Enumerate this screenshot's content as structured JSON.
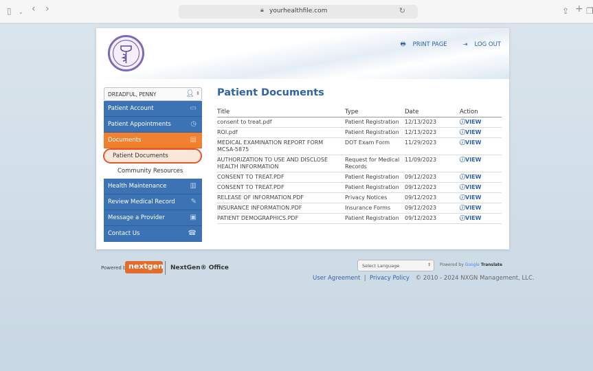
{
  "browser": {
    "url": "yourhealthfile.com",
    "sidebar_icon": "sidebar-icon",
    "back_glyph": "‹",
    "forward_glyph": "›"
  },
  "header": {
    "print_label": "PRINT PAGE",
    "logout_label": "LOG OUT"
  },
  "patient_select": {
    "value": "DREADFUL, PENNY"
  },
  "nav": {
    "items": [
      {
        "label": "Patient Account",
        "icon": "id-card-icon"
      },
      {
        "label": "Patient Appointments",
        "icon": "clock-icon"
      },
      {
        "label": "Documents",
        "icon": "document-icon",
        "active": true
      }
    ],
    "sub_items": [
      {
        "label": "Patient Documents",
        "selected": true
      },
      {
        "label": "Community Resources"
      }
    ],
    "items_after": [
      {
        "label": "Health Maintenance",
        "icon": "bar-chart-icon"
      },
      {
        "label": "Review Medical Record",
        "icon": "edit-icon"
      },
      {
        "label": "Message a Provider",
        "icon": "message-icon"
      },
      {
        "label": "Contact Us",
        "icon": "phone-icon"
      }
    ]
  },
  "main": {
    "title": "Patient Documents",
    "columns": [
      "Title",
      "Type",
      "Date",
      "Action"
    ],
    "view_label": "VIEW",
    "rows": [
      {
        "title": "consent to treat.pdf",
        "type": "Patient Registration",
        "date": "12/13/2023"
      },
      {
        "title": "ROI.pdf",
        "type": "Patient Registration",
        "date": "12/13/2023"
      },
      {
        "title": "MEDICAL EXAMINATION REPORT FORM MCSA-5875",
        "type": "DOT Exam Form",
        "date": "11/29/2023"
      },
      {
        "title": "AUTHORIZATION TO USE AND DISCLOSE HEALTH INFORMATION",
        "type": "Request for Medical Records",
        "date": "11/09/2023"
      },
      {
        "title": "CONSENT TO TREAT.PDF",
        "type": "Patient Registration",
        "date": "09/12/2023"
      },
      {
        "title": "CONSENT TO TREAT.PDF",
        "type": "Patient Registration",
        "date": "09/12/2023"
      },
      {
        "title": "RELEASE OF INFORMATION.PDF",
        "type": "Privacy Notices",
        "date": "09/12/2023"
      },
      {
        "title": "INSURANCE INFORMATION.PDF",
        "type": "Insurance Forms",
        "date": "09/12/2023"
      },
      {
        "title": "PATIENT DEMOGRAPHICS.PDF",
        "type": "Patient Registration",
        "date": "09/12/2023"
      }
    ]
  },
  "footer": {
    "powered_by": "Powered by",
    "brand_logo": "nextgen",
    "brand_office": "NextGen® Office",
    "language_select": "Select Language",
    "translate_prefix": "Powered by",
    "translate_google": "Google",
    "translate_word": "Translate",
    "user_agreement": "User Agreement",
    "privacy_policy": "Privacy Policy",
    "copyright": "© 2010 - 2024 NXGN Management, LLC."
  },
  "colors": {
    "nav_blue": "#3c73b4",
    "nav_active": "#ef8130",
    "link_blue": "#2f64a9",
    "highlight_ring": "#e8542b"
  }
}
